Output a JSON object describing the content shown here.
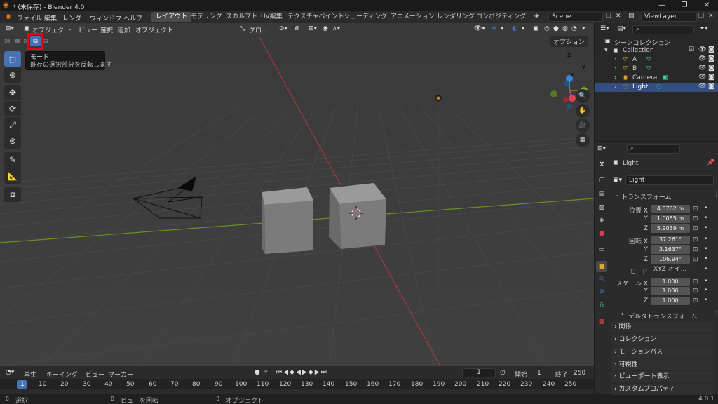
{
  "titlebar": {
    "title": "* (未保存) - Blender 4.0"
  },
  "menu": {
    "items": [
      "ファイル",
      "編集",
      "レンダー",
      "ウィンドウ",
      "ヘルプ"
    ],
    "workspaces": [
      "レイアウト",
      "モデリング",
      "スカルプト",
      "UV編集",
      "テクスチャペイント",
      "シェーディング",
      "アニメーション",
      "レンダリング",
      "コンポジティング"
    ],
    "scene": "Scene",
    "view_layer": "ViewLayer"
  },
  "viewport_header": {
    "mode": "オブジェク...",
    "menus": [
      "ビュー",
      "選択",
      "追加",
      "オブジェクト"
    ],
    "transform_orientation": "グロ...",
    "options": "オプション"
  },
  "tooltip": {
    "title": "モード",
    "description": "既存の選択部分を反転します"
  },
  "gizmo": {
    "x": "X",
    "y": "Y",
    "z": "Z"
  },
  "timeline": {
    "menus": [
      "再生",
      "キーイング",
      "ビュー",
      "マーカー"
    ],
    "current_frame": "1",
    "start_label": "開始",
    "start": "1",
    "end_label": "終了",
    "end": "250",
    "ruler": [
      "1",
      "10",
      "20",
      "30",
      "40",
      "50",
      "60",
      "70",
      "80",
      "90",
      "100",
      "110",
      "120",
      "130",
      "140",
      "150",
      "160",
      "170",
      "180",
      "190",
      "200",
      "210",
      "220",
      "230",
      "240",
      "250"
    ]
  },
  "statusbar": {
    "select": "選択",
    "rotate": "ビューを回転",
    "object": "オブジェクト",
    "version": "4.0.1"
  },
  "outliner": {
    "root": "シーンコレクション",
    "collection": "Collection",
    "items": [
      "A",
      "B",
      "Camera",
      "Light"
    ]
  },
  "properties": {
    "object_name": "Light",
    "data_name": "Light",
    "transform_title": "トランスフォーム",
    "location_label": "位置 X",
    "rotation_label": "回転 X",
    "scale_label": "スケール X",
    "axis_y": "Y",
    "axis_z": "Z",
    "location": [
      "4.0762 m",
      "1.0055 m",
      "5.9039 m"
    ],
    "rotation": [
      "37.261°",
      "3.1637°",
      "106.94°"
    ],
    "mode_label": "モード",
    "rotation_mode": "XYZ オイ...",
    "scale": [
      "1.000",
      "1.000",
      "1.000"
    ],
    "delta_transform": "デルタトランスフォーム",
    "panels": [
      "関係",
      "コレクション",
      "モーションパス",
      "可視性",
      "ビューポート表示",
      "カスタムプロパティ"
    ]
  },
  "colors": {
    "accent": "#4772b3",
    "highlight": "#e8001d",
    "x_axis": "#e04050",
    "y_axis": "#7aab2a",
    "z_axis": "#3d84e0"
  }
}
